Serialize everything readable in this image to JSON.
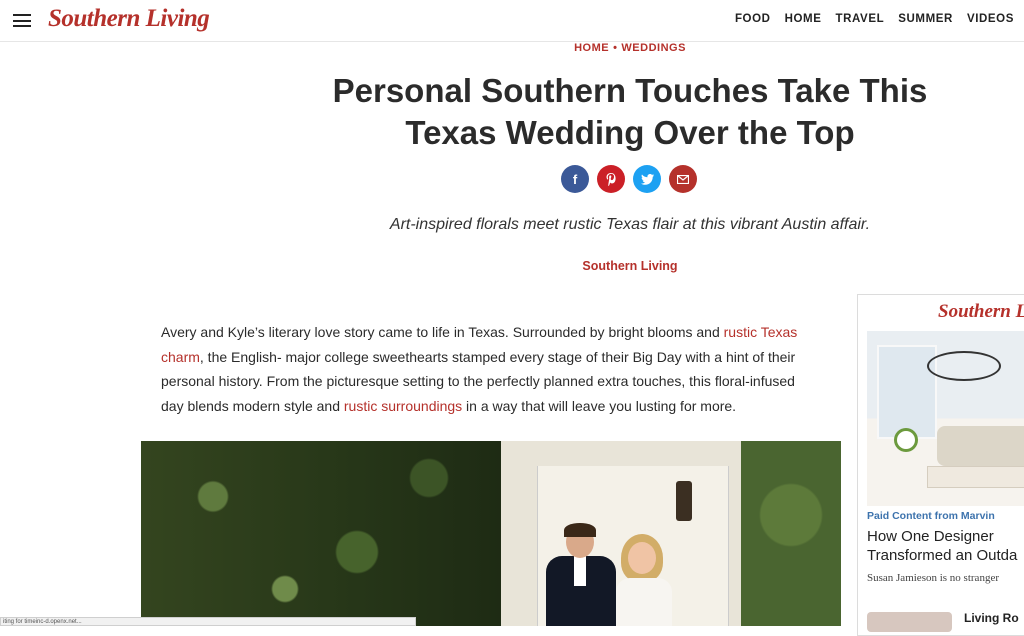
{
  "header": {
    "logo": "Southern Living",
    "nav": [
      "FOOD",
      "HOME",
      "TRAVEL",
      "SUMMER",
      "VIDEOS"
    ]
  },
  "breadcrumb": [
    "HOME",
    "WEDDINGS"
  ],
  "article": {
    "title": "Personal Southern Touches Take This Texas Wedding Over the Top",
    "dek": "Art-inspired florals meet rustic Texas flair at this vibrant Austin affair.",
    "byline": "Southern Living",
    "share_icons": [
      "facebook-icon",
      "pinterest-icon",
      "twitter-icon",
      "email-icon"
    ],
    "body": {
      "p1_start": "Avery and Kyle’s literary love story came to life in Texas. Surrounded by bright blooms and ",
      "link1": "rustic Texas charm",
      "p1_mid": ", the English- major college sweethearts stamped every stage of their Big Day with a hint of their personal history. From the picturesque setting to the perfectly planned extra touches, this floral-infused day blends modern style and ",
      "link2": "rustic surroundings",
      "p1_end": " in a way that will leave you lusting for more."
    }
  },
  "ad": {
    "logo": "Southern Living",
    "sponsor": "Paid Content from Marvin",
    "headline_line1": "How One Designer",
    "headline_line2": "Transformed an Outda",
    "author": "Susan Jamieson is no stranger",
    "next_title": "Living Ro"
  },
  "status_bar": "iting for timeinc-d.openx.net..."
}
